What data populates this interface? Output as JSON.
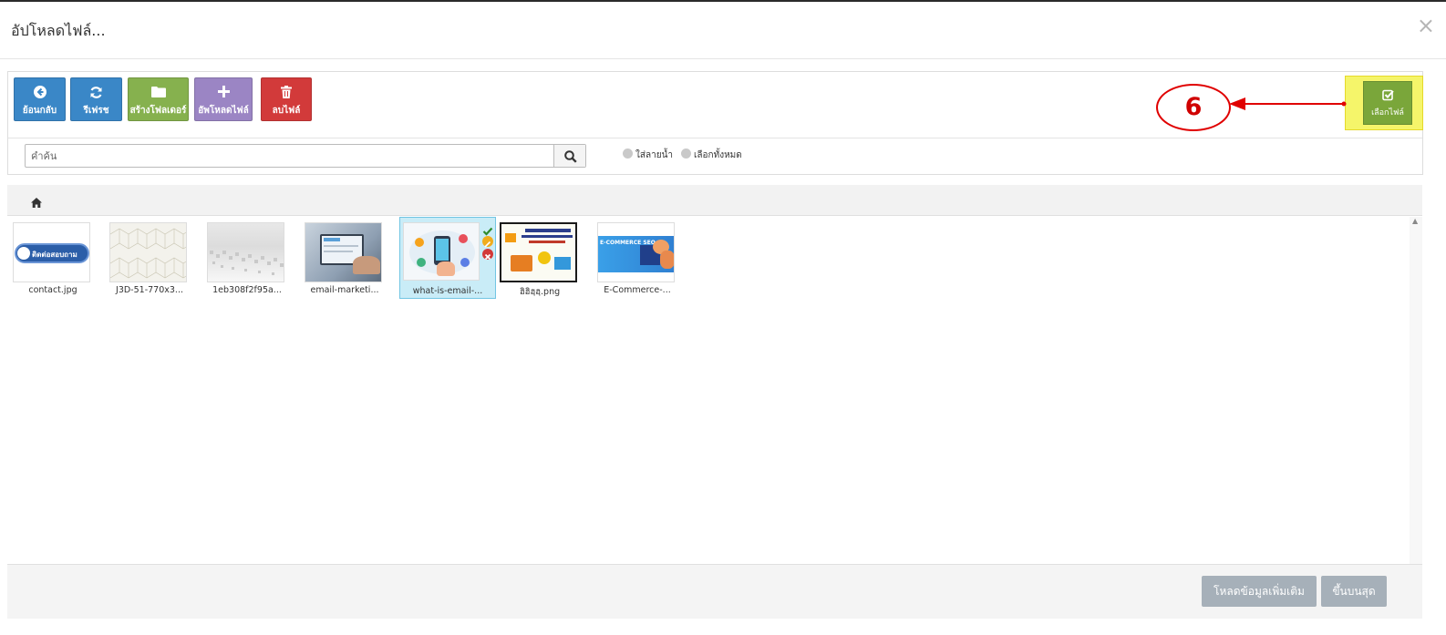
{
  "modal": {
    "title": "อัปโหลดไฟล์...",
    "close": "×"
  },
  "toolbar": {
    "back": "ย้อนกลับ",
    "refresh": "รีเฟรช",
    "new_folder": "สร้างโฟลเดอร์",
    "upload": "อัพโหลดไฟล์",
    "delete": "ลบไฟล์",
    "select": "เลือกไฟล์"
  },
  "annotation": {
    "number": "6"
  },
  "search": {
    "placeholder": "คำค้น"
  },
  "options": {
    "watermark": "ใส่ลายน้ำ",
    "select_all": "เลือกทั้งหมด"
  },
  "files": [
    {
      "name": "contact.jpg",
      "thumb_text": "ติดต่อสอบถาม"
    },
    {
      "name": "J3D-51-770x3..."
    },
    {
      "name": "1eb308f2f95a..."
    },
    {
      "name": "email-marketi..."
    },
    {
      "name": "what-is-email-...",
      "selected": true
    },
    {
      "name": "ฮิฮิฮฺฮฺ.png"
    },
    {
      "name": "E-Commerce-...",
      "thumb_text": "E-COMMERCE SEO"
    }
  ],
  "footer": {
    "load_more": "โหลดข้อมูลเพิ่มเติม",
    "to_top": "ขึ้นบนสุด"
  },
  "colors": {
    "primary": "#3a87c7",
    "success": "#86b14e",
    "purple": "#9b85c4",
    "danger": "#d23a3a",
    "highlight": "#f5f56a",
    "annotation": "#e00000"
  }
}
